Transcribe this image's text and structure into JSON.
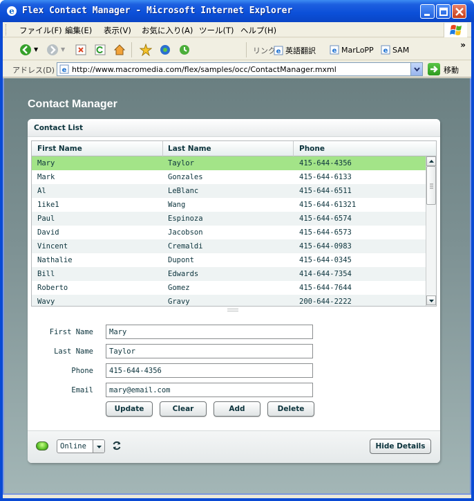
{
  "window": {
    "title": "Flex Contact Manager - Microsoft Internet Explorer"
  },
  "menu": {
    "items": [
      "ファイル(F)",
      "編集(E)",
      "表示(V)",
      "お気に入り(A)",
      "ツール(T)",
      "ヘルプ(H)"
    ]
  },
  "toolbar": {
    "icons": [
      "back-icon",
      "forward-icon",
      "stop-icon",
      "refresh-icon",
      "home-icon",
      "favorites-icon",
      "media-icon",
      "history-icon"
    ],
    "links_label": "リンク",
    "links": [
      "英語翻訳",
      "MarLoPP",
      "SAM"
    ],
    "chevron": "»"
  },
  "address": {
    "label": "アドレス(D)",
    "url": "http://www.macromedia.com/flex/samples/occ/ContactManager.mxml",
    "go_label": "移動"
  },
  "app": {
    "title": "Contact Manager",
    "panel_title": "Contact List",
    "columns": [
      "First Name",
      "Last Name",
      "Phone"
    ],
    "contacts": [
      {
        "first": "Mary",
        "last": "Taylor",
        "phone": "415-644-4356"
      },
      {
        "first": "Mark",
        "last": "Gonzales",
        "phone": "415-644-6133"
      },
      {
        "first": "Al",
        "last": "LeBlanc",
        "phone": "415-644-6511"
      },
      {
        "first": "1ike1",
        "last": "Wang",
        "phone": "415-644-61321"
      },
      {
        "first": "Paul",
        "last": "Espinoza",
        "phone": "415-644-6574"
      },
      {
        "first": "David",
        "last": "Jacobson",
        "phone": "415-644-6573"
      },
      {
        "first": "Vincent",
        "last": "Cremaldi",
        "phone": "415-644-0983"
      },
      {
        "first": "Nathalie",
        "last": "Dupont",
        "phone": "415-644-0345"
      },
      {
        "first": "Bill",
        "last": "Edwards",
        "phone": "414-644-7354"
      },
      {
        "first": "Roberto",
        "last": "Gomez",
        "phone": "415-644-7644"
      },
      {
        "first": "Wavy",
        "last": "Gravy",
        "phone": "200-644-2222"
      }
    ],
    "selected_index": 0,
    "form": {
      "labels": {
        "first": "First Name",
        "last": "Last Name",
        "phone": "Phone",
        "email": "Email"
      },
      "values": {
        "first": "Mary",
        "last": "Taylor",
        "phone": "415-644-4356",
        "email": "mary@email.com"
      }
    },
    "buttons": {
      "update": "Update",
      "clear": "Clear",
      "add": "Add",
      "delete": "Delete"
    },
    "status": {
      "mode": "Online",
      "led_color": "#5ec32a"
    },
    "hide_details": "Hide Details"
  }
}
